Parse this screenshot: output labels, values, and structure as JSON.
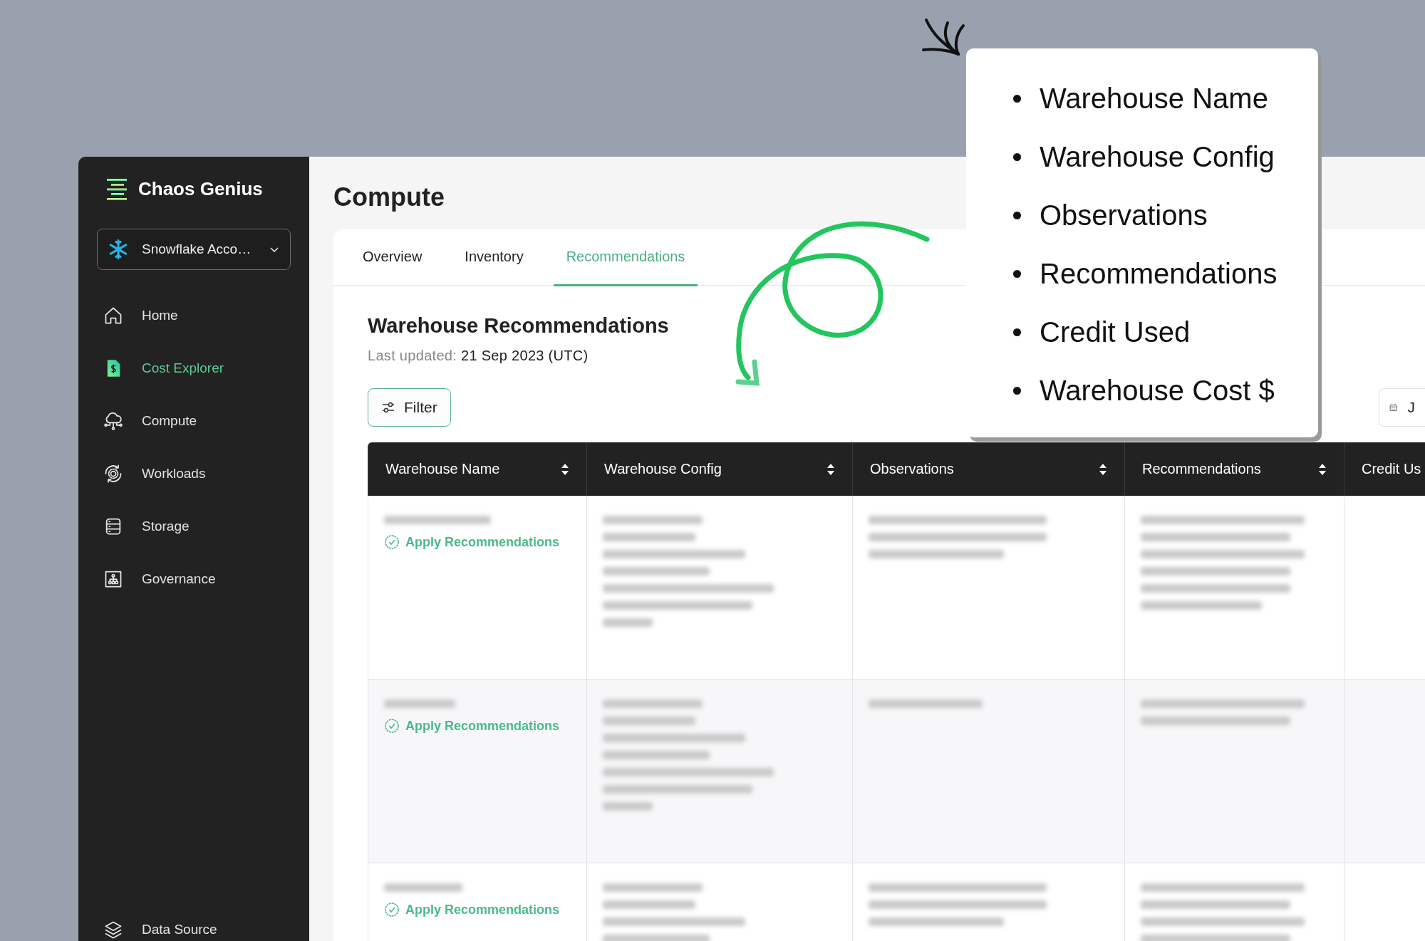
{
  "sidebar": {
    "brand": "Chaos Genius",
    "account": {
      "label": "Snowflake Acco…"
    },
    "items": [
      {
        "label": "Home",
        "selected": false
      },
      {
        "label": "Cost Explorer",
        "selected": true
      },
      {
        "label": "Compute",
        "selected": false
      },
      {
        "label": "Workloads",
        "selected": false
      },
      {
        "label": "Storage",
        "selected": false
      },
      {
        "label": "Governance",
        "selected": false
      }
    ],
    "footer_item": {
      "label": "Data Source",
      "selected": false
    }
  },
  "page": {
    "title": "Compute",
    "tabs": [
      {
        "label": "Overview",
        "selected": false
      },
      {
        "label": "Inventory",
        "selected": false
      },
      {
        "label": "Recommendations",
        "selected": true
      }
    ],
    "section_title": "Warehouse Recommendations",
    "last_updated_label": "Last updated:",
    "last_updated_value": "21 Sep 2023 (UTC)",
    "filter_button": "Filter",
    "date_button": "J",
    "table": {
      "columns": [
        {
          "label": "Warehouse Name",
          "sortable": true
        },
        {
          "label": "Warehouse Config",
          "sortable": true
        },
        {
          "label": "Observations",
          "sortable": true
        },
        {
          "label": "Recommendations",
          "sortable": true
        },
        {
          "label": "Credit Us"
        }
      ],
      "rows": [
        {
          "action": "Apply Recommendations"
        },
        {
          "action": "Apply Recommendations"
        },
        {
          "action": "Apply Recommendations"
        }
      ]
    }
  },
  "callout": {
    "items": [
      "Warehouse Name",
      "Warehouse Config",
      "Observations",
      "Recommendations",
      "Credit Used",
      "Warehouse Cost $"
    ]
  }
}
